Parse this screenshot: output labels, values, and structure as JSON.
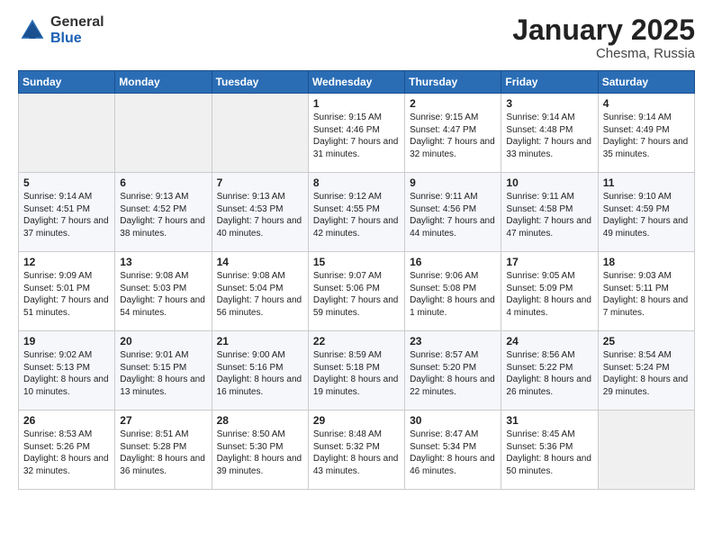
{
  "logo": {
    "general": "General",
    "blue": "Blue",
    "icon": "▶"
  },
  "header": {
    "month": "January 2025",
    "location": "Chesma, Russia"
  },
  "weekdays": [
    "Sunday",
    "Monday",
    "Tuesday",
    "Wednesday",
    "Thursday",
    "Friday",
    "Saturday"
  ],
  "rows": [
    [
      {
        "day": "",
        "text": ""
      },
      {
        "day": "",
        "text": ""
      },
      {
        "day": "",
        "text": ""
      },
      {
        "day": "1",
        "text": "Sunrise: 9:15 AM\nSunset: 4:46 PM\nDaylight: 7 hours and 31 minutes."
      },
      {
        "day": "2",
        "text": "Sunrise: 9:15 AM\nSunset: 4:47 PM\nDaylight: 7 hours and 32 minutes."
      },
      {
        "day": "3",
        "text": "Sunrise: 9:14 AM\nSunset: 4:48 PM\nDaylight: 7 hours and 33 minutes."
      },
      {
        "day": "4",
        "text": "Sunrise: 9:14 AM\nSunset: 4:49 PM\nDaylight: 7 hours and 35 minutes."
      }
    ],
    [
      {
        "day": "5",
        "text": "Sunrise: 9:14 AM\nSunset: 4:51 PM\nDaylight: 7 hours and 37 minutes."
      },
      {
        "day": "6",
        "text": "Sunrise: 9:13 AM\nSunset: 4:52 PM\nDaylight: 7 hours and 38 minutes."
      },
      {
        "day": "7",
        "text": "Sunrise: 9:13 AM\nSunset: 4:53 PM\nDaylight: 7 hours and 40 minutes."
      },
      {
        "day": "8",
        "text": "Sunrise: 9:12 AM\nSunset: 4:55 PM\nDaylight: 7 hours and 42 minutes."
      },
      {
        "day": "9",
        "text": "Sunrise: 9:11 AM\nSunset: 4:56 PM\nDaylight: 7 hours and 44 minutes."
      },
      {
        "day": "10",
        "text": "Sunrise: 9:11 AM\nSunset: 4:58 PM\nDaylight: 7 hours and 47 minutes."
      },
      {
        "day": "11",
        "text": "Sunrise: 9:10 AM\nSunset: 4:59 PM\nDaylight: 7 hours and 49 minutes."
      }
    ],
    [
      {
        "day": "12",
        "text": "Sunrise: 9:09 AM\nSunset: 5:01 PM\nDaylight: 7 hours and 51 minutes."
      },
      {
        "day": "13",
        "text": "Sunrise: 9:08 AM\nSunset: 5:03 PM\nDaylight: 7 hours and 54 minutes."
      },
      {
        "day": "14",
        "text": "Sunrise: 9:08 AM\nSunset: 5:04 PM\nDaylight: 7 hours and 56 minutes."
      },
      {
        "day": "15",
        "text": "Sunrise: 9:07 AM\nSunset: 5:06 PM\nDaylight: 7 hours and 59 minutes."
      },
      {
        "day": "16",
        "text": "Sunrise: 9:06 AM\nSunset: 5:08 PM\nDaylight: 8 hours and 1 minute."
      },
      {
        "day": "17",
        "text": "Sunrise: 9:05 AM\nSunset: 5:09 PM\nDaylight: 8 hours and 4 minutes."
      },
      {
        "day": "18",
        "text": "Sunrise: 9:03 AM\nSunset: 5:11 PM\nDaylight: 8 hours and 7 minutes."
      }
    ],
    [
      {
        "day": "19",
        "text": "Sunrise: 9:02 AM\nSunset: 5:13 PM\nDaylight: 8 hours and 10 minutes."
      },
      {
        "day": "20",
        "text": "Sunrise: 9:01 AM\nSunset: 5:15 PM\nDaylight: 8 hours and 13 minutes."
      },
      {
        "day": "21",
        "text": "Sunrise: 9:00 AM\nSunset: 5:16 PM\nDaylight: 8 hours and 16 minutes."
      },
      {
        "day": "22",
        "text": "Sunrise: 8:59 AM\nSunset: 5:18 PM\nDaylight: 8 hours and 19 minutes."
      },
      {
        "day": "23",
        "text": "Sunrise: 8:57 AM\nSunset: 5:20 PM\nDaylight: 8 hours and 22 minutes."
      },
      {
        "day": "24",
        "text": "Sunrise: 8:56 AM\nSunset: 5:22 PM\nDaylight: 8 hours and 26 minutes."
      },
      {
        "day": "25",
        "text": "Sunrise: 8:54 AM\nSunset: 5:24 PM\nDaylight: 8 hours and 29 minutes."
      }
    ],
    [
      {
        "day": "26",
        "text": "Sunrise: 8:53 AM\nSunset: 5:26 PM\nDaylight: 8 hours and 32 minutes."
      },
      {
        "day": "27",
        "text": "Sunrise: 8:51 AM\nSunset: 5:28 PM\nDaylight: 8 hours and 36 minutes."
      },
      {
        "day": "28",
        "text": "Sunrise: 8:50 AM\nSunset: 5:30 PM\nDaylight: 8 hours and 39 minutes."
      },
      {
        "day": "29",
        "text": "Sunrise: 8:48 AM\nSunset: 5:32 PM\nDaylight: 8 hours and 43 minutes."
      },
      {
        "day": "30",
        "text": "Sunrise: 8:47 AM\nSunset: 5:34 PM\nDaylight: 8 hours and 46 minutes."
      },
      {
        "day": "31",
        "text": "Sunrise: 8:45 AM\nSunset: 5:36 PM\nDaylight: 8 hours and 50 minutes."
      },
      {
        "day": "",
        "text": ""
      }
    ]
  ]
}
